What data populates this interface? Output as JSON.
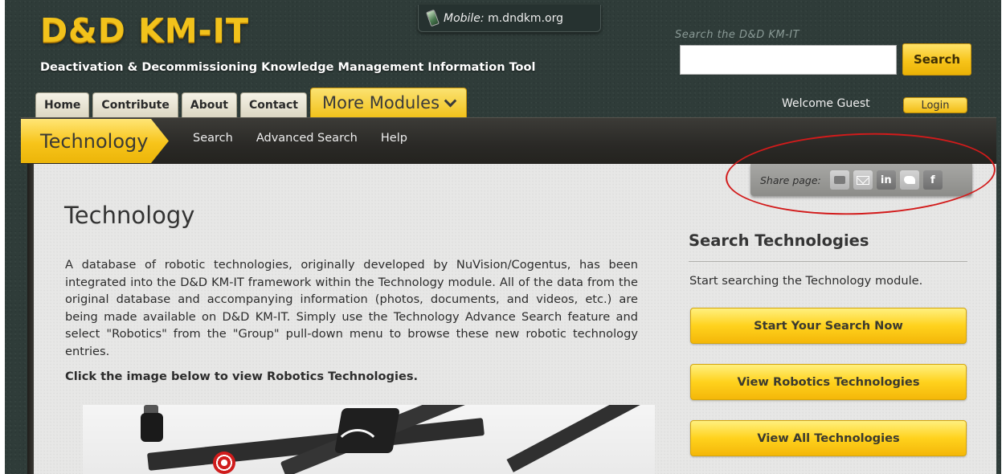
{
  "header": {
    "logo": "D&D KM-IT",
    "tagline": "Deactivation & Decommissioning Knowledge Management Information Tool",
    "mobile_label": "Mobile:",
    "mobile_url": "m.dndkm.org",
    "search_caption": "Search the D&D KM-IT",
    "search_value": "",
    "search_button": "Search",
    "welcome": "Welcome Guest",
    "login_button": "Login"
  },
  "tabs": [
    "Home",
    "Contribute",
    "About",
    "Contact",
    "More Modules"
  ],
  "module": {
    "title": "Technology",
    "subnav": [
      "Search",
      "Advanced Search",
      "Help"
    ]
  },
  "share": {
    "label": "Share page:",
    "icons": [
      "print-icon",
      "email-icon",
      "linkedin-icon",
      "twitter-icon",
      "facebook-icon"
    ],
    "linkedin_text": "in",
    "facebook_text": "f"
  },
  "main": {
    "heading": "Technology",
    "intro": "A database of robotic technologies, originally developed by NuVision/Cogentus, has been integrated into the D&D KM-IT framework within the Technology module. All of the data from the original database and accompanying information (photos, documents, and videos, etc.) are being made available on D&D KM-IT. Simply use the Technology Advance Search feature and select \"Robotics\" from the \"Group\" pull-down menu to browse these new robotic technology entries.",
    "click_line": "Click the image below to view Robotics Technologies."
  },
  "sidebar": {
    "title": "Search Technologies",
    "text": "Start searching the Technology module.",
    "buttons": [
      "Start Your Search Now",
      "View Robotics Technologies",
      "View All Technologies"
    ]
  },
  "colors": {
    "accent_yellow": "#f7c41a",
    "background_dark": "#2f3c39",
    "annotation_red": "#d21b1b"
  }
}
